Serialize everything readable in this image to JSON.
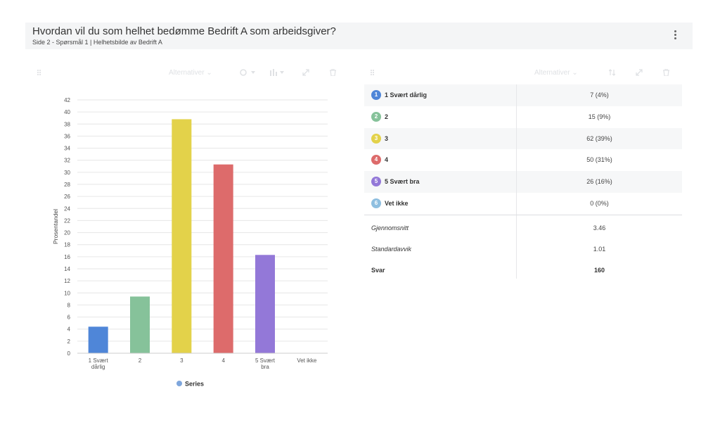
{
  "header": {
    "title": "Hvordan vil du som helhet bedømme Bedrift A som arbeidsgiver?",
    "subtitle": "Side 2 - Spørsmål 1 | Helhetsbilde av Bedrift A"
  },
  "toolbar": {
    "alternatives_label": "Alternativer",
    "icons": [
      "grip-icon",
      "chevron-down-icon",
      "palette-icon",
      "bar-chart-icon",
      "expand-icon",
      "trash-icon",
      "sort-icon"
    ]
  },
  "chart_data": {
    "type": "bar",
    "categories": [
      "1 Svært dårlig",
      "2",
      "3",
      "4",
      "5 Svært bra",
      "Vet ikke"
    ],
    "values": [
      4.4,
      9.4,
      38.8,
      31.3,
      16.3,
      0
    ],
    "colors": [
      "#4f86d8",
      "#86c29a",
      "#e3d24a",
      "#dd6b6b",
      "#9378d8",
      "#8fbfe0"
    ],
    "ylabel": "Prosentandel",
    "xlabel": "",
    "ylim": [
      0,
      42
    ],
    "yticks": [
      0,
      2,
      4,
      6,
      8,
      10,
      12,
      14,
      16,
      18,
      20,
      22,
      24,
      26,
      28,
      30,
      32,
      34,
      36,
      38,
      40,
      42
    ],
    "grid": true,
    "legend": {
      "position": "bottom",
      "entries": [
        {
          "name": "Series",
          "color": "#7ea6dc"
        }
      ]
    }
  },
  "table": {
    "rows": [
      {
        "num": "1",
        "label": "1 Svært dårlig",
        "value": "7 (4%)",
        "color": "#4f86d8"
      },
      {
        "num": "2",
        "label": "2",
        "value": "15 (9%)",
        "color": "#86c29a"
      },
      {
        "num": "3",
        "label": "3",
        "value": "62 (39%)",
        "color": "#e3d24a"
      },
      {
        "num": "4",
        "label": "4",
        "value": "50 (31%)",
        "color": "#dd6b6b"
      },
      {
        "num": "5",
        "label": "5 Svært bra",
        "value": "26 (16%)",
        "color": "#9378d8"
      },
      {
        "num": "6",
        "label": "Vet ikke",
        "value": "0 (0%)",
        "color": "#8fbfe0"
      }
    ],
    "stats": [
      {
        "label": "Gjennomsnitt",
        "value": "3.46"
      },
      {
        "label": "Standardavvik",
        "value": "1.01"
      },
      {
        "label": "Svar",
        "value": "160"
      }
    ]
  }
}
